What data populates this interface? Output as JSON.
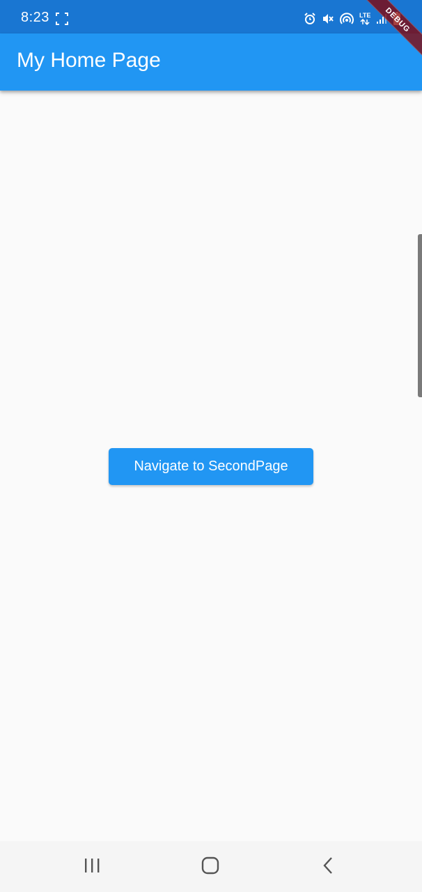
{
  "status_bar": {
    "time": "8:23",
    "network_label": "LTE",
    "color": "#1976d2",
    "icons": [
      "screenshot-icon",
      "alarm-icon",
      "mute-icon",
      "hotspot-icon",
      "lte-icon",
      "signal-icon",
      "battery-icon"
    ]
  },
  "debug_banner": {
    "label": "DEBUG"
  },
  "app_bar": {
    "title": "My Home Page",
    "color": "#2196f3"
  },
  "main": {
    "navigate_button_label": "Navigate to SecondPage",
    "button_color": "#2196f3",
    "background": "#fafafa"
  },
  "system_nav": {
    "buttons": [
      "recent-apps-icon",
      "home-icon",
      "back-icon"
    ]
  }
}
